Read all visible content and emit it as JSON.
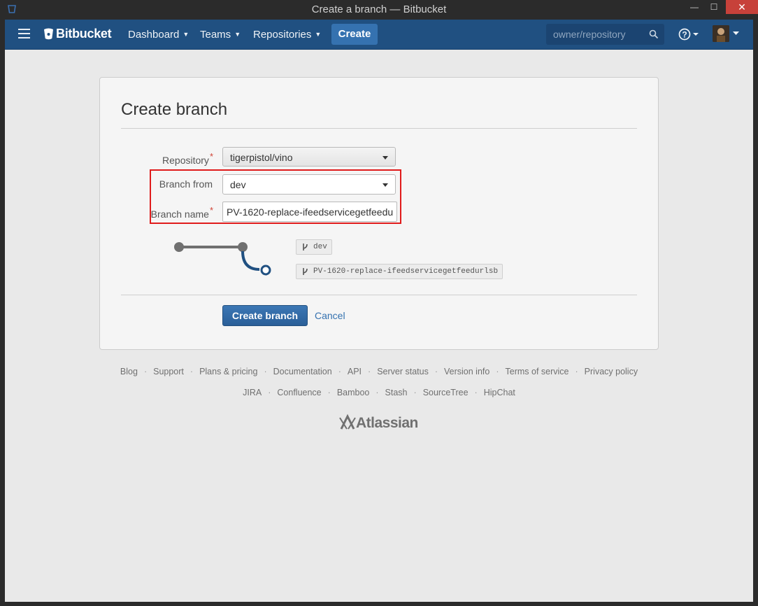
{
  "window": {
    "title": "Create a branch — Bitbucket",
    "minimize_label": "—",
    "maximize_label": "☐",
    "close_label": "✕"
  },
  "nav": {
    "logo": "Bitbucket",
    "items": [
      {
        "label": "Dashboard"
      },
      {
        "label": "Teams"
      },
      {
        "label": "Repositories"
      }
    ],
    "create_label": "Create",
    "search_placeholder": "owner/repository"
  },
  "form": {
    "title": "Create branch",
    "repository_label": "Repository",
    "repository_value": "tigerpistol/vino",
    "branch_from_label": "Branch from",
    "branch_from_value": "dev",
    "branch_name_label": "Branch name",
    "branch_name_value": "PV-1620-replace-ifeedservicegetfeedurlsb",
    "required_mark": "*",
    "diagram": {
      "source_branch": "dev",
      "new_branch": "PV-1620-replace-ifeedservicegetfeedurlsb"
    },
    "submit_label": "Create branch",
    "cancel_label": "Cancel"
  },
  "footer": {
    "row1": [
      "Blog",
      "Support",
      "Plans & pricing",
      "Documentation",
      "API",
      "Server status",
      "Version info",
      "Terms of service",
      "Privacy policy"
    ],
    "row2": [
      "JIRA",
      "Confluence",
      "Bamboo",
      "Stash",
      "SourceTree",
      "HipChat"
    ],
    "separator": "·",
    "brand": "Atlassian"
  },
  "colors": {
    "navbar": "#205081",
    "primary_button": "#3572b0",
    "highlight_border": "#e01b1b",
    "required": "#d04437"
  }
}
